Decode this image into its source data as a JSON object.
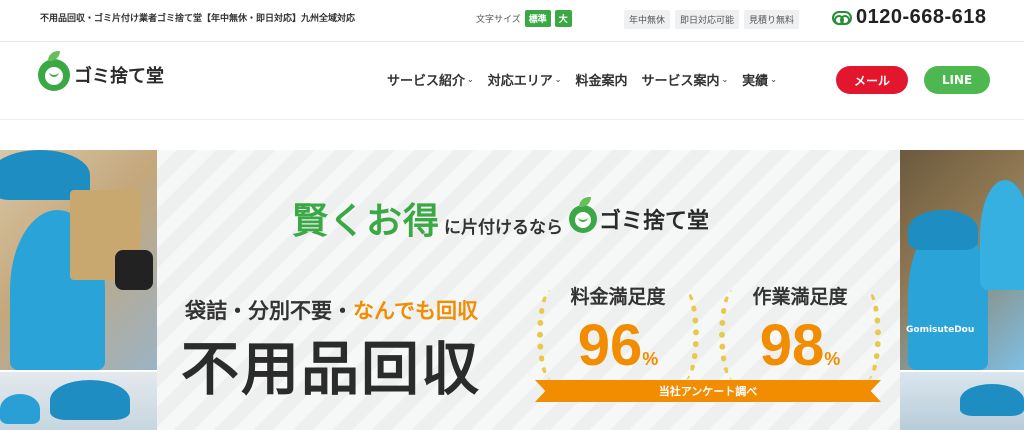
{
  "topbar": {
    "tagline": "不用品回収・ゴミ片付け業者ゴミ捨て堂【年中無休・即日対応】九州全域対応",
    "font_size_label": "文字サイズ",
    "font_size_options": [
      "標準",
      "大"
    ],
    "badges": [
      "年中無休",
      "即日対応可能",
      "見積り無料"
    ],
    "phone": "0120-668-618",
    "phone_icon": "freedial-icon"
  },
  "header": {
    "logo_text": "ゴミ捨て堂",
    "nav": [
      {
        "label": "サービス紹介",
        "has_dropdown": true
      },
      {
        "label": "対応エリア",
        "has_dropdown": true
      },
      {
        "label": "料金案内",
        "has_dropdown": false
      },
      {
        "label": "サービス案内",
        "has_dropdown": true
      },
      {
        "label": "実績",
        "has_dropdown": true
      }
    ],
    "mail_label": "メール",
    "line_label": "LINE"
  },
  "hero": {
    "headline_big": "賢くお得",
    "headline_small": "に片付けるなら",
    "headline_logo": "ゴミ捨て堂",
    "sub_part1": "袋詰・分別不要・",
    "sub_part2": "なんでも回収",
    "main_title": "不用品回収",
    "stats": [
      {
        "label": "料金満足度",
        "value": "96",
        "unit": "%"
      },
      {
        "label": "作業満足度",
        "value": "98",
        "unit": "%"
      }
    ],
    "ribbon": "当社アンケート調べ",
    "photo_text": "GomisuteDou"
  },
  "colors": {
    "brand_green": "#3aa845",
    "accent_orange": "#f28c00",
    "mail_red": "#e3162d",
    "line_green": "#4cb84f"
  }
}
